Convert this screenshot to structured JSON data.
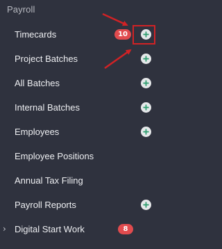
{
  "section": {
    "title": "Payroll"
  },
  "menu": {
    "items": [
      {
        "label": "Timecards",
        "badge": "10",
        "has_add": true
      },
      {
        "label": "Project Batches",
        "badge": null,
        "has_add": true
      },
      {
        "label": "All Batches",
        "badge": null,
        "has_add": true
      },
      {
        "label": "Internal Batches",
        "badge": null,
        "has_add": true
      },
      {
        "label": "Employees",
        "badge": null,
        "has_add": true
      },
      {
        "label": "Employee Positions",
        "badge": null,
        "has_add": false
      },
      {
        "label": "Annual Tax Filing",
        "badge": null,
        "has_add": false
      },
      {
        "label": "Payroll Reports",
        "badge": null,
        "has_add": true
      },
      {
        "label": "Digital Start Work",
        "badge": "8",
        "has_add": false
      }
    ]
  },
  "colors": {
    "background": "#2f323e",
    "badge": "#e14b4e",
    "add_button_bg": "#e6e8ea",
    "add_button_plus": "#2f9d6f",
    "annotation": "#d12225"
  },
  "icons": {
    "add": "plus-circle-icon",
    "expand": "chevron-right-icon"
  }
}
